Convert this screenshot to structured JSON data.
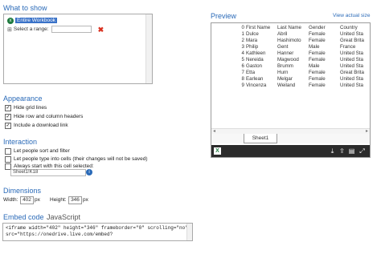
{
  "what_to_show": {
    "heading": "What to show",
    "entire_label": "Entire Workbook",
    "select_range_label": "Select a range:"
  },
  "appearance": {
    "heading": "Appearance",
    "options": [
      {
        "label": "Hide grid lines",
        "checked": true
      },
      {
        "label": "Hide row and column headers",
        "checked": true
      },
      {
        "label": "Include a download link",
        "checked": true
      }
    ]
  },
  "interaction": {
    "heading": "Interaction",
    "options": [
      {
        "label": "Let people sort and filter",
        "checked": false
      },
      {
        "label": "Let people type into cells (their changes will not be saved)",
        "checked": false
      },
      {
        "label": "Always start with this cell selected:",
        "checked": false
      }
    ],
    "cell_value": "Sheet1!K18"
  },
  "dimensions": {
    "heading": "Dimensions",
    "width_label": "Width:",
    "width_value": "402",
    "width_unit": "px",
    "height_label": "Height:",
    "height_value": "346",
    "height_unit": "px"
  },
  "embed": {
    "heading": "Embed code",
    "format": "JavaScript",
    "code": "<iframe width=\"402\" height=\"346\" frameborder=\"0\" scrolling=\"no\" src=\"https://onedrive.live.com/embed?"
  },
  "preview": {
    "heading": "Preview",
    "actual_size_link": "View actual size",
    "sheet_tab": "Sheet1",
    "columns": [
      "",
      "First Name",
      "Last Name",
      "Gender",
      "Country"
    ],
    "rows": [
      [
        "1",
        "Dulce",
        "Abril",
        "Female",
        "United Sta"
      ],
      [
        "2",
        "Mara",
        "Hashimoto",
        "Female",
        "Great Brita"
      ],
      [
        "3",
        "Philip",
        "Gent",
        "Male",
        "France"
      ],
      [
        "4",
        "Kathleen",
        "Hanner",
        "Female",
        "United Sta"
      ],
      [
        "5",
        "Nereida",
        "Magwood",
        "Female",
        "United Sta"
      ],
      [
        "6",
        "Gaston",
        "Brumm",
        "Male",
        "United Sta"
      ],
      [
        "7",
        "Etta",
        "Hurn",
        "Female",
        "Great Brita"
      ],
      [
        "8",
        "Earlean",
        "Melgar",
        "Female",
        "United Sta"
      ],
      [
        "9",
        "Vincenza",
        "Weiland",
        "Female",
        "United Sta"
      ]
    ],
    "header_row_index": "0"
  }
}
